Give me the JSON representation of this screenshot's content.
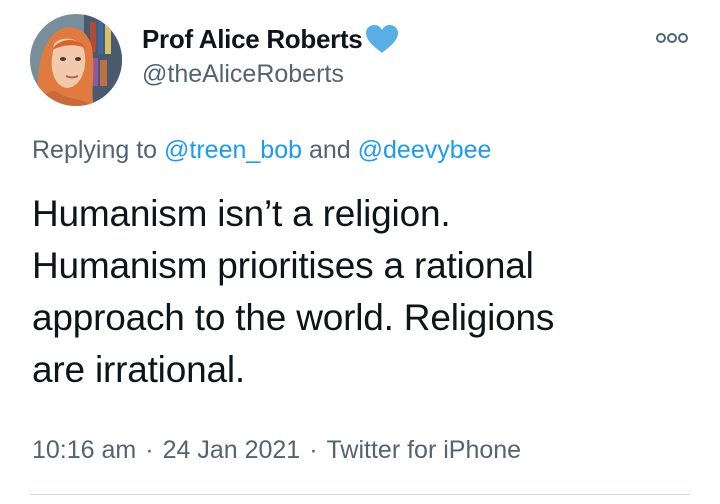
{
  "author": {
    "display_name": "Prof Alice Roberts",
    "handle": "@theAliceRoberts",
    "verified_color": "#1d9bf0"
  },
  "reply": {
    "prefix": "Replying to",
    "mention_1": "@treen_bob",
    "conjunction": "and",
    "mention_2": "@deevybee"
  },
  "tweet_text": {
    "lines": [
      "Humanism isn’t a religion.",
      "Humanism prioritises a rational",
      "approach to the world. Religions",
      "are irrational."
    ]
  },
  "meta": {
    "time": "10:16 am",
    "separator": "·",
    "date": "24 Jan 2021",
    "source": "Twitter for iPhone"
  },
  "icons": {
    "more": "more-options-icon",
    "verified": "verified-heart-icon"
  },
  "colors": {
    "text": "#0f1419",
    "secondary": "#536471",
    "link": "#1d9bf0"
  }
}
